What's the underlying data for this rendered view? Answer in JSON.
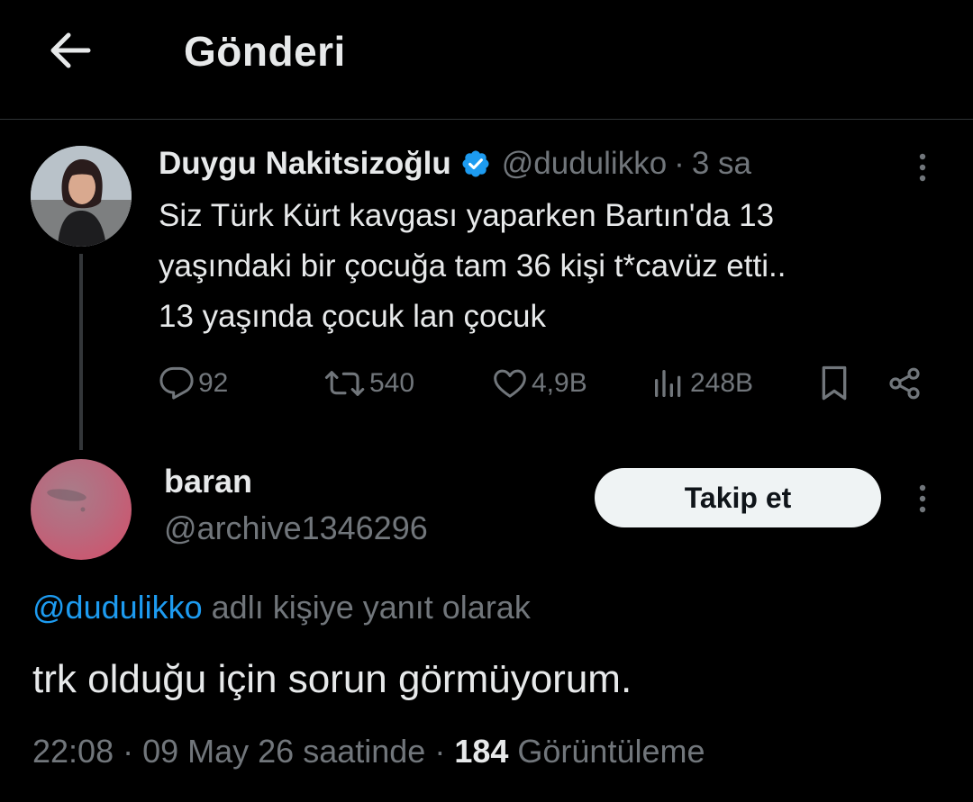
{
  "header": {
    "title": "Gönderi",
    "back_icon": "arrow-left-icon"
  },
  "original_tweet": {
    "display_name": "Duygu Nakitsizoğlu",
    "verified_icon": "verified-badge-icon",
    "handle": "@dudulikko",
    "separator": "·",
    "time": "3 sa",
    "text_lines": [
      "Siz Türk Kürt kavgası yaparken Bartın'da 13",
      "yaşındaki bir çocuğa tam 36 kişi t*cavüz etti..",
      "13 yaşında çocuk lan çocuk"
    ],
    "actions": {
      "replies": "92",
      "retweets": "540",
      "likes": "4,9B",
      "views": "248B"
    }
  },
  "reply": {
    "display_name": "baran",
    "handle": "@archive1346296",
    "follow_label": "Takip et",
    "replying_mention": "@dudulikko",
    "replying_suffix": " adlı kişiye yanıt olarak",
    "text": "trk olduğu için sorun görmüyorum.",
    "meta": {
      "time": "22:08",
      "separator1": " · ",
      "date": "09 May 26 saatinde",
      "separator2": " · ",
      "view_count": "184",
      "view_label": " Görüntüleme"
    }
  },
  "colors": {
    "background": "#000000",
    "text_primary": "#e7e9ea",
    "text_secondary": "#71767b",
    "accent": "#1d9bf0",
    "divider": "#2f3336"
  }
}
